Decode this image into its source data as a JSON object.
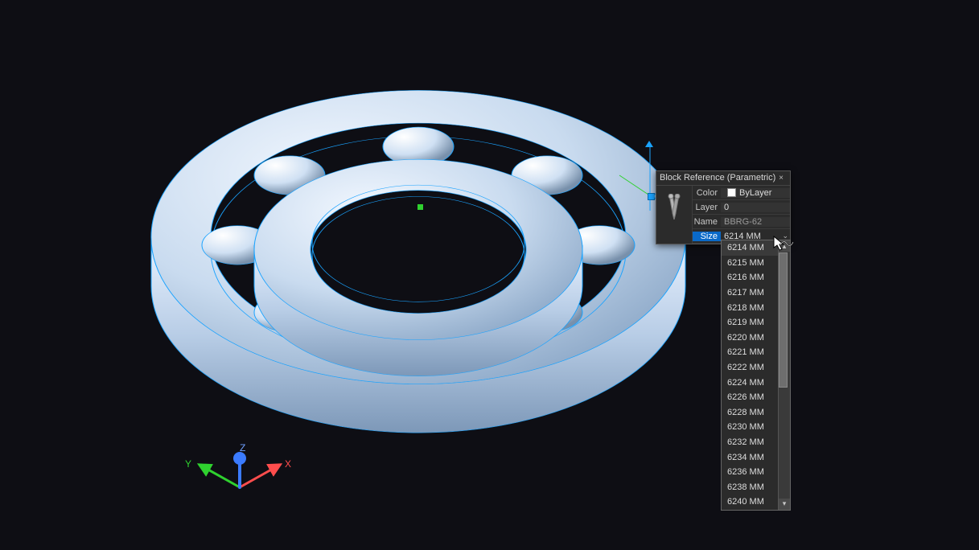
{
  "panel": {
    "title": "Block Reference (Parametric)",
    "rows": {
      "color_label": "Color",
      "color_value": "ByLayer",
      "layer_label": "Layer",
      "layer_value": "0",
      "name_label": "Name",
      "name_value": "BBRG-62",
      "size_label": "Size",
      "size_value": "6214 MM"
    }
  },
  "dropdown": {
    "items": [
      "6214 MM",
      "6215 MM",
      "6216 MM",
      "6217 MM",
      "6218 MM",
      "6219 MM",
      "6220 MM",
      "6221 MM",
      "6222 MM",
      "6224 MM",
      "6226 MM",
      "6228 MM",
      "6230 MM",
      "6232 MM",
      "6234 MM",
      "6236 MM",
      "6238 MM",
      "6240 MM"
    ],
    "selected_index": 0
  },
  "ucs": {
    "x": "X",
    "y": "Y",
    "z": "Z"
  }
}
